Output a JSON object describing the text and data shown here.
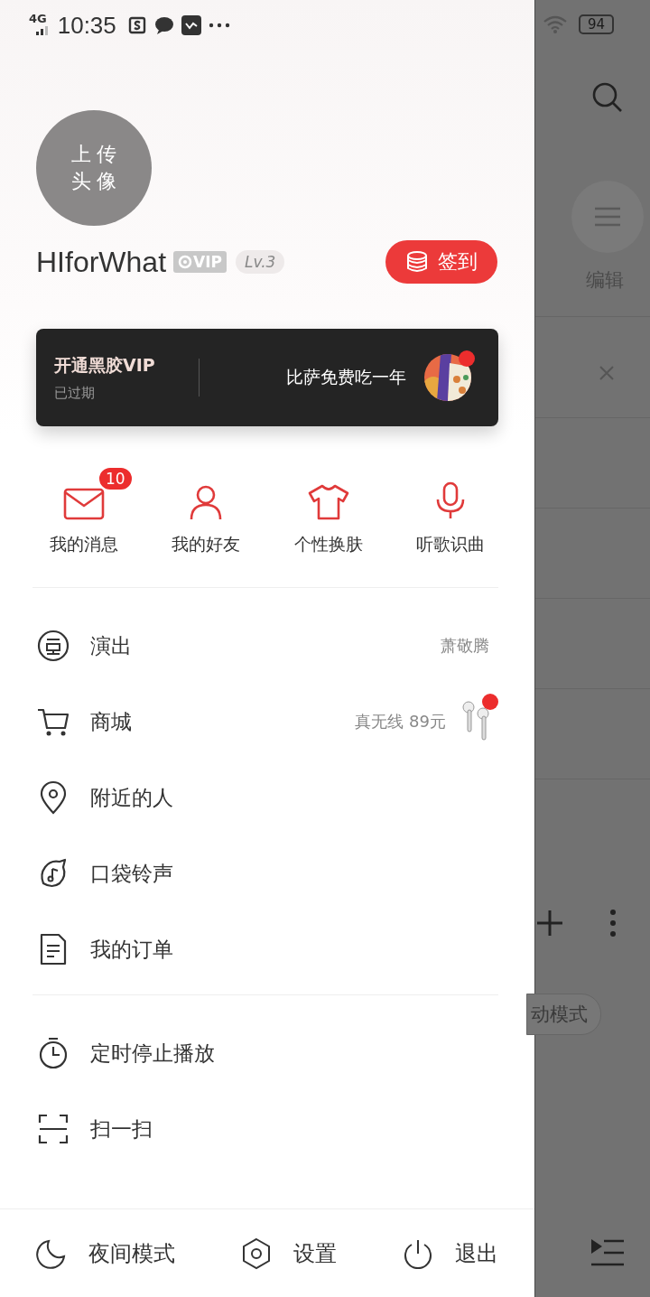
{
  "status_bar": {
    "network": "4G",
    "time": "10:35",
    "battery": "94"
  },
  "profile": {
    "avatar_lines": [
      "上 传",
      "头 像"
    ],
    "username": "HIforWhat",
    "vip_badge": "VIP",
    "level": "Lv.3",
    "checkin_button": "签到"
  },
  "vip_card": {
    "title": "开通黑胶VIP",
    "subtitle": "已过期",
    "promo": "比萨免费吃一年",
    "promo_dot": true
  },
  "shortcuts": [
    {
      "label": "我的消息",
      "badge": "10"
    },
    {
      "label": "我的好友"
    },
    {
      "label": "个性换肤"
    },
    {
      "label": "听歌识曲"
    }
  ],
  "menu_groups": [
    [
      {
        "label": "演出",
        "detail": "萧敬腾"
      },
      {
        "label": "商城",
        "detail": "真无线 89元",
        "dot": true
      },
      {
        "label": "附近的人"
      },
      {
        "label": "口袋铃声"
      },
      {
        "label": "我的订单"
      }
    ],
    [
      {
        "label": "定时停止播放"
      },
      {
        "label": "扫一扫"
      }
    ]
  ],
  "bottom_bar": [
    {
      "label": "夜间模式"
    },
    {
      "label": "设置"
    },
    {
      "label": "退出"
    }
  ],
  "background": {
    "edit_label": "编辑",
    "mode_chip": "动模式"
  }
}
